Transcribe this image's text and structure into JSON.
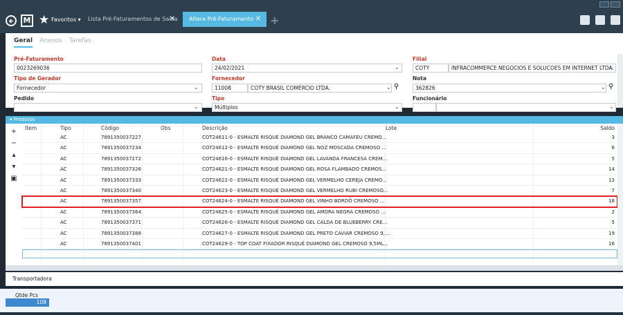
{
  "top": {
    "favorites": "Favoritos",
    "favorites_arrow": "▾",
    "tab1": "Lista Pré-Faturamentos de Saída",
    "tab2": "Altera Pré-Faturamento",
    "close": "✕",
    "add": "+"
  },
  "subtabs": [
    "Geral",
    "Anexos",
    "Tarefas"
  ],
  "form": {
    "pre_faturamento_label": "Pré-Faturamento",
    "pre_faturamento": "0023269036",
    "tipo_gerador_label": "Tipo de Gerador",
    "tipo_gerador": "Fornecedor",
    "pedido_label": "Pedido",
    "pedido": "",
    "data_label": "Data",
    "data": "24/02/2021",
    "fornecedor_label": "Fornecedor",
    "fornecedor_code": "11008",
    "fornecedor_name": "COTY BRASIL COMÉRCIO LTDA.",
    "tipo_label": "Tipo",
    "tipo": "Múltiplos",
    "filial_label": "Filial",
    "filial_code": "COTY",
    "filial_name": "INFRACOMMERCE NEGOCIOS E SOLUCOES EM INTERNET LTDA.",
    "nota_label": "Nota",
    "nota": "362826",
    "funcionario_label": "Funcionário",
    "funcionario": ""
  },
  "produtos_label": "Produtos",
  "grid": {
    "headers": {
      "item": "Item",
      "tipo": "Tipo",
      "codigo": "Código",
      "obs": "Obs",
      "descricao": "Descrição",
      "lote": "Lote",
      "saldo": "Saldo"
    },
    "rows": [
      {
        "tipo": "AC",
        "codigo": "7891350037227",
        "desc": "COT24611-0 - ESMALTE RISQUÉ DIAMOND GEL BRANCO CAMAFEU CREMO...",
        "saldo": "3"
      },
      {
        "tipo": "AC",
        "codigo": "7891350037234",
        "desc": "COT24612-0 - ESMALTE RISQUÉ DIAMOND GEL NOZ MOSCADA CREMOSO ...",
        "saldo": "6"
      },
      {
        "tipo": "AC",
        "codigo": "7891350037272",
        "desc": "COT24616-0 - ESMALTE RISQUÉ DIAMOND GEL LAVANDA FRANCESA CREM...",
        "saldo": "5"
      },
      {
        "tipo": "AC",
        "codigo": "7891350037326",
        "desc": "COT24621-0 - ESMALTE RISQUÉ DIAMOND GEL ROSA FLAMBADO CREMOS...",
        "saldo": "14"
      },
      {
        "tipo": "AC",
        "codigo": "7891350037333",
        "desc": "COT24622-0 - ESMALTE RISQUÉ DIAMOND GEL VERMELHO CEREJA CREMO...",
        "saldo": "13"
      },
      {
        "tipo": "AC",
        "codigo": "7891350037340",
        "desc": "COT24623-0 - ESMALTE RISQUÉ DIAMOND GEL VERMELHO RUBI CREMOSO...",
        "saldo": "7"
      },
      {
        "tipo": "AC",
        "codigo": "7891350037357",
        "desc": "COT24624-0 - ESMALTE RISQUÉ DIAMOND GEL VINHO BORDÔ CREMOSO ...",
        "saldo": "18"
      },
      {
        "tipo": "AC",
        "codigo": "7891350037364",
        "desc": "COT24625-0 - ESMALTE RISQUÉ DIAMOND GEL AMORA NEGRA CREMOSO ...",
        "saldo": "2"
      },
      {
        "tipo": "AC",
        "codigo": "7891350037371",
        "desc": "COT24626-0 - ESMALTE RISQUÉ DIAMOND GEL CALDA DE BLUEBERRY CRE...",
        "saldo": "5"
      },
      {
        "tipo": "AC",
        "codigo": "7891350037388",
        "desc": "COT24627-0 - ESMALTE RISQUÉ DIAMOND GEL PRETO CAVIAR CREMOSO 9,...",
        "saldo": "19"
      },
      {
        "tipo": "AC",
        "codigo": "7891350037401",
        "desc": "COT24629-0 - TOP COAT FIXADOR RISQUÉ DIAMOND GEL CREMOSO 9,5ML...",
        "saldo": "16"
      }
    ],
    "selected_index": 6
  },
  "transportadora": "Transportadora",
  "footer": {
    "qtde_label": "Qtde Pcs",
    "qtde_value": "108"
  },
  "colors": {
    "accent": "#55b9e3",
    "highlight": "#e02020",
    "required_label": "#c0392b"
  }
}
